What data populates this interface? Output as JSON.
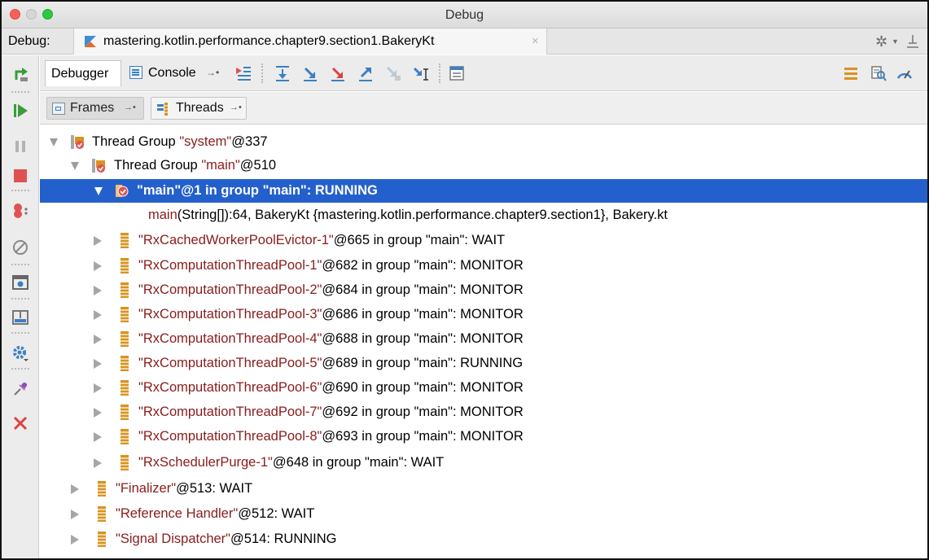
{
  "window": {
    "title": "Debug"
  },
  "debug_tabs": {
    "label": "Debug:",
    "session": "mastering.kotlin.performance.chapter9.section1.BakeryKt",
    "close": "×"
  },
  "toolbar": {
    "tabs": [
      {
        "label": "Debugger"
      },
      {
        "label": "Console"
      }
    ]
  },
  "subtoolbar": {
    "frames": "Frames",
    "threads": "Threads"
  },
  "tree": {
    "rows": [
      {
        "prefix": "Thread Group ",
        "name": "\"system\"",
        "suffix": "@337"
      },
      {
        "prefix": "Thread Group ",
        "name": "\"main\"",
        "suffix": "@510"
      },
      {
        "name": "\"main\"",
        "suffix": "@1 in group \"main\": RUNNING"
      },
      {
        "method": "main",
        "suffix": "(String[]):64, BakeryKt {mastering.kotlin.performance.chapter9.section1}, Bakery.kt"
      },
      {
        "name": "\"RxCachedWorkerPoolEvictor-1\"",
        "suffix": "@665 in group \"main\": WAIT"
      },
      {
        "name": "\"RxComputationThreadPool-1\"",
        "suffix": "@682 in group \"main\": MONITOR"
      },
      {
        "name": "\"RxComputationThreadPool-2\"",
        "suffix": "@684 in group \"main\": MONITOR"
      },
      {
        "name": "\"RxComputationThreadPool-3\"",
        "suffix": "@686 in group \"main\": MONITOR"
      },
      {
        "name": "\"RxComputationThreadPool-4\"",
        "suffix": "@688 in group \"main\": MONITOR"
      },
      {
        "name": "\"RxComputationThreadPool-5\"",
        "suffix": "@689 in group \"main\": RUNNING"
      },
      {
        "name": "\"RxComputationThreadPool-6\"",
        "suffix": "@690 in group \"main\": MONITOR"
      },
      {
        "name": "\"RxComputationThreadPool-7\"",
        "suffix": "@692 in group \"main\": MONITOR"
      },
      {
        "name": "\"RxComputationThreadPool-8\"",
        "suffix": "@693 in group \"main\": MONITOR"
      },
      {
        "name": "\"RxSchedulerPurge-1\"",
        "suffix": "@648 in group \"main\": WAIT"
      },
      {
        "name": "\"Finalizer\"",
        "suffix": "@513: WAIT"
      },
      {
        "name": "\"Reference Handler\"",
        "suffix": "@512: WAIT"
      },
      {
        "name": "\"Signal Dispatcher\"",
        "suffix": "@514: RUNNING"
      }
    ]
  },
  "colors": {
    "selection": "#2460cc",
    "thread_name": "#8a1b1b"
  }
}
